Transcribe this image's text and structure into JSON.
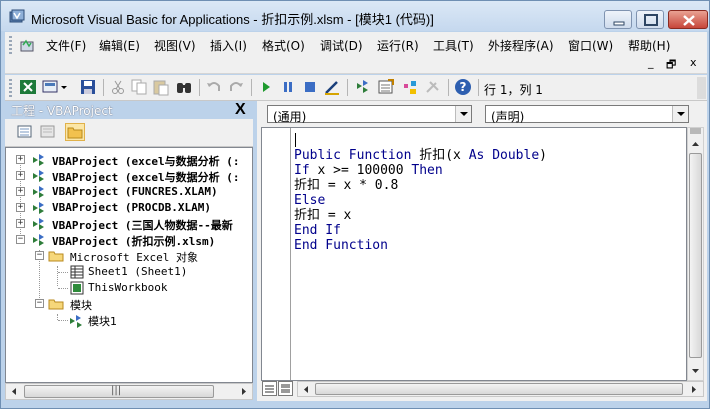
{
  "window": {
    "title": "Microsoft Visual Basic for Applications - 折扣示例.xlsm - [模块1 (代码)]"
  },
  "menubar": {
    "items": [
      {
        "label": "文件(F)"
      },
      {
        "label": "编辑(E)"
      },
      {
        "label": "视图(V)"
      },
      {
        "label": "插入(I)"
      },
      {
        "label": "格式(O)"
      },
      {
        "label": "调试(D)"
      },
      {
        "label": "运行(R)"
      },
      {
        "label": "工具(T)"
      },
      {
        "label": "外接程序(A)"
      },
      {
        "label": "窗口(W)"
      },
      {
        "label": "帮助(H)"
      }
    ],
    "mdi_min": "_",
    "mdi_restore": "🗗",
    "mdi_close": "x"
  },
  "toolbar": {
    "status": "行 1，列 1"
  },
  "project_explorer": {
    "title": "工程 - VBAProject",
    "close": "X",
    "tree": [
      {
        "label": "VBAProject (excel与数据分析 (:",
        "bold": true
      },
      {
        "label": "VBAProject (excel与数据分析 (:",
        "bold": true
      },
      {
        "label": "VBAProject (FUNCRES.XLAM)",
        "bold": true
      },
      {
        "label": "VBAProject (PROCDB.XLAM)",
        "bold": true
      },
      {
        "label": "VBAProject (三国人物数据--最新",
        "bold": true
      },
      {
        "label": "VBAProject (折扣示例.xlsm)",
        "bold": true
      },
      {
        "label": "Microsoft Excel 对象",
        "bold": false
      },
      {
        "label": "Sheet1 (Sheet1)",
        "bold": false
      },
      {
        "label": "ThisWorkbook",
        "bold": false
      },
      {
        "label": "模块",
        "bold": false
      },
      {
        "label": "模块1",
        "bold": false
      }
    ],
    "scroll_thumb_glyph": "|||"
  },
  "code_window": {
    "object_combo": "(通用)",
    "procedure_combo": "(声明)",
    "lines": [
      {
        "parts": [
          {
            "t": "Public Function ",
            "kw": true
          },
          {
            "t": "折扣(x ",
            "kw": false
          },
          {
            "t": "As Double",
            "kw": true
          },
          {
            "t": ")",
            "kw": false
          }
        ]
      },
      {
        "parts": [
          {
            "t": "If ",
            "kw": true
          },
          {
            "t": "x >= 100000 ",
            "kw": false
          },
          {
            "t": "Then",
            "kw": true
          }
        ]
      },
      {
        "parts": [
          {
            "t": "折扣 = x * 0.8",
            "kw": false
          }
        ]
      },
      {
        "parts": [
          {
            "t": "Else",
            "kw": true
          }
        ]
      },
      {
        "parts": [
          {
            "t": "折扣 = x",
            "kw": false
          }
        ]
      },
      {
        "parts": [
          {
            "t": "End If",
            "kw": true
          }
        ]
      },
      {
        "parts": [
          {
            "t": "End Function",
            "kw": true
          }
        ]
      }
    ]
  },
  "colors": {
    "keyword": "#00008b",
    "text": "#000000",
    "title_bar": "#c5d8ee"
  }
}
